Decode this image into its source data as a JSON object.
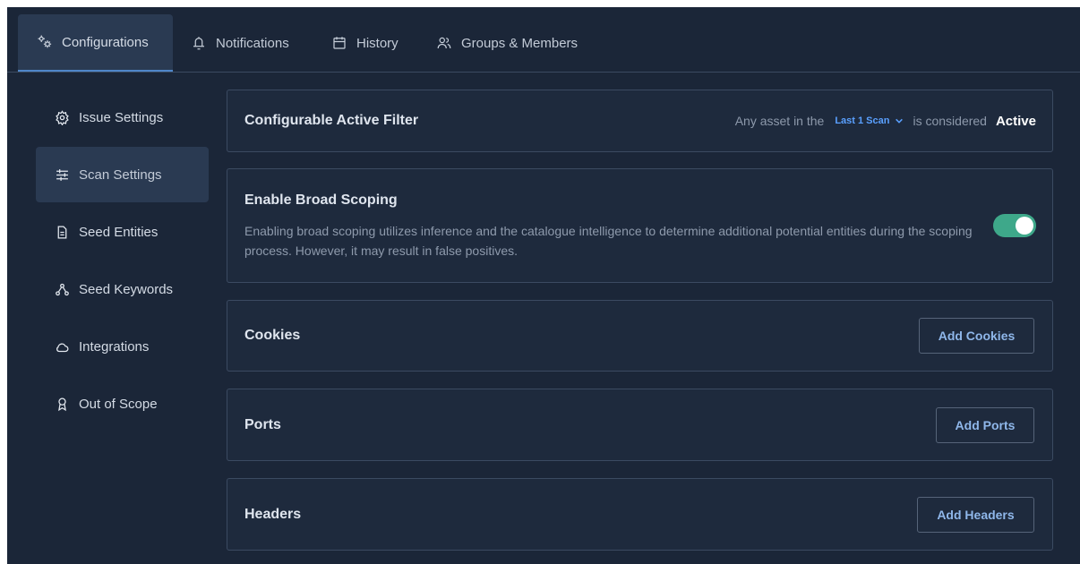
{
  "tabs": [
    {
      "label": "Configurations",
      "icon": "cogs-icon",
      "active": true
    },
    {
      "label": "Notifications",
      "icon": "bell-icon",
      "active": false
    },
    {
      "label": "History",
      "icon": "calendar-icon",
      "active": false
    },
    {
      "label": "Groups & Members",
      "icon": "users-icon",
      "active": false
    }
  ],
  "sidebar": {
    "items": [
      {
        "label": "Issue Settings",
        "icon": "gear-icon"
      },
      {
        "label": "Scan Settings",
        "icon": "sliders-icon",
        "active": true
      },
      {
        "label": "Seed Entities",
        "icon": "document-icon"
      },
      {
        "label": "Seed Keywords",
        "icon": "network-icon"
      },
      {
        "label": "Integrations",
        "icon": "cloud-icon"
      },
      {
        "label": "Out of Scope",
        "icon": "award-icon"
      }
    ]
  },
  "active_filter": {
    "title": "Configurable Active Filter",
    "prefix": "Any asset in the",
    "selected": "Last 1 Scan",
    "middle": "is considered",
    "status": "Active"
  },
  "broad_scoping": {
    "title": "Enable Broad Scoping",
    "description": "Enabling broad scoping utilizes inference and the catalogue intelligence to determine additional potential entities during the scoping process. However, it may result in false positives.",
    "enabled": true
  },
  "cookies": {
    "title": "Cookies",
    "button": "Add Cookies"
  },
  "ports": {
    "title": "Ports",
    "button": "Add Ports"
  },
  "headers": {
    "title": "Headers",
    "button": "Add Headers"
  },
  "colors": {
    "background": "#1b2638",
    "accent": "#4f86c9",
    "link": "#5aa0ff",
    "toggle_on": "#3ea88a"
  }
}
